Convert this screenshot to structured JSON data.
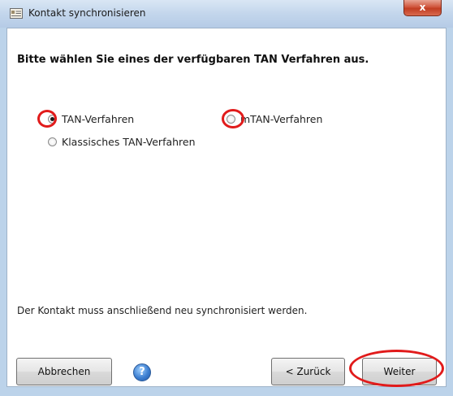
{
  "window": {
    "title": "Kontakt synchronisieren",
    "close_glyph": "x",
    "accent_color": "#bcd3ea"
  },
  "main": {
    "heading": "Bitte wählen Sie eines der verfügbaren TAN Verfahren aus.",
    "options": [
      {
        "label": "TAN-Verfahren",
        "selected": true,
        "icon": "radio-button"
      },
      {
        "label": "mTAN-Verfahren",
        "selected": false,
        "icon": "radio-button"
      },
      {
        "label": "Klassisches TAN-Verfahren",
        "selected": false,
        "icon": "radio-button"
      }
    ],
    "note": "Der Kontakt muss anschließend neu synchronisiert werden."
  },
  "footer": {
    "cancel_label": "Abbrechen",
    "help_glyph": "?",
    "back_label": "< Zurück",
    "next_label": "Weiter"
  },
  "annotations": {
    "highlight_color": "#e11b1b"
  }
}
